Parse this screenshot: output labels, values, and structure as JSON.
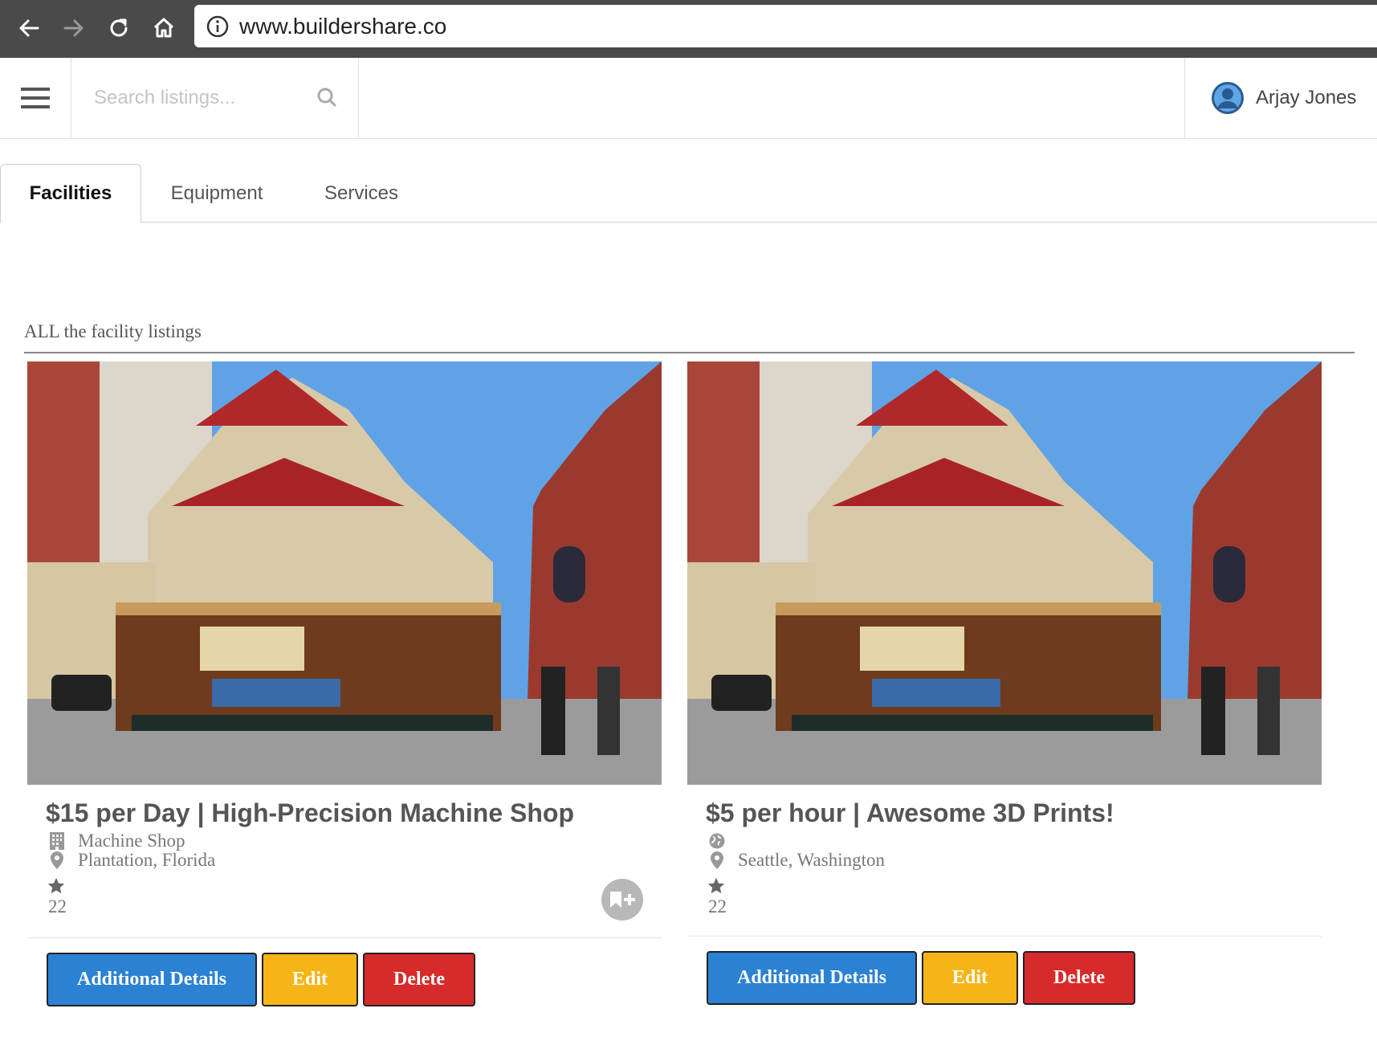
{
  "browser": {
    "url": "www.buildershare.co"
  },
  "header": {
    "search_placeholder": "Search listings...",
    "user_name": "Arjay Jones"
  },
  "tabs": [
    {
      "label": "Facilities",
      "active": true
    },
    {
      "label": "Equipment",
      "active": false
    },
    {
      "label": "Services",
      "active": false
    }
  ],
  "section": {
    "title": "ALL the facility listings"
  },
  "listings": [
    {
      "title": "$15 per Day | High-Precision Machine Shop",
      "category": "Machine Shop",
      "category_icon": "building-icon",
      "location": "Plantation, Florida",
      "rating_count": "22",
      "buttons": {
        "details": "Additional Details",
        "edit": "Edit",
        "delete": "Delete"
      }
    },
    {
      "title": "$5 per hour | Awesome 3D Prints!",
      "category": "",
      "category_icon": "globe-icon",
      "location": "Seattle, Washington",
      "rating_count": "22",
      "buttons": {
        "details": "Additional Details",
        "edit": "Edit",
        "delete": "Delete"
      }
    }
  ],
  "colors": {
    "details": "#2b82d2",
    "edit": "#f6b417",
    "delete": "#d72a2a"
  }
}
